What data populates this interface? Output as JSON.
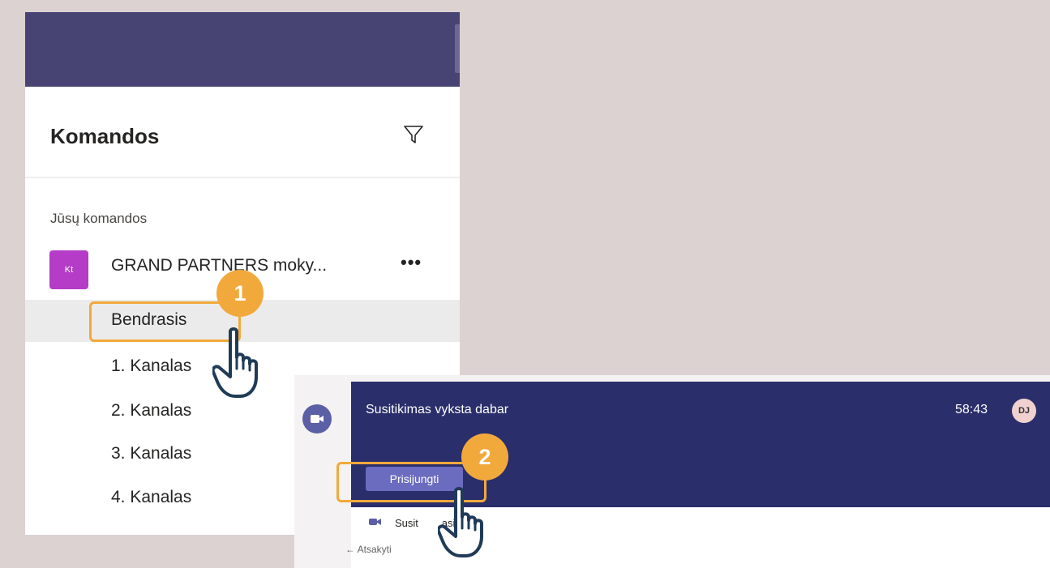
{
  "teams_panel": {
    "title": "Komandos",
    "section_label": "Jūsų komandos",
    "team": {
      "avatar_initials": "Kt",
      "name": "GRAND PARTNERS moky...",
      "more": "•••"
    },
    "channels": [
      "Bendrasis",
      "1. Kanalas",
      "2. Kanalas",
      "3. Kanalas",
      "4. Kanalas"
    ]
  },
  "meeting": {
    "title": "Susitikimas vyksta dabar",
    "timer": "58:43",
    "avatar_initials": "DJ",
    "join_label": "Prisijungti",
    "footer_text": "Susit        asidėjo",
    "reply_label": "← Atsakyti"
  },
  "callouts": {
    "step1": "1",
    "step2": "2"
  },
  "colors": {
    "background": "#dbd2d1",
    "top_bar": "#474473",
    "banner": "#2a2e6a",
    "accent_orange": "#f2a93b",
    "team_avatar": "#b43cc7",
    "join_button": "#6b6bbf"
  },
  "icons": [
    "filter-icon",
    "video-camera-icon",
    "pointing-hand-icon",
    "more-icon"
  ]
}
